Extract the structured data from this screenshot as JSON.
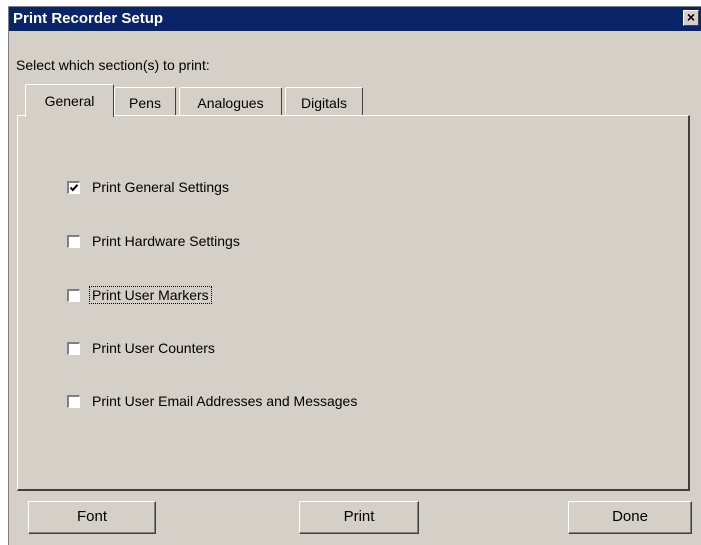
{
  "window": {
    "title": "Print Recorder Setup",
    "close_glyph": "×"
  },
  "prompt": "Select which section(s) to print:",
  "tabs": [
    {
      "label": "General",
      "active": true
    },
    {
      "label": "Pens",
      "active": false
    },
    {
      "label": "Analogues",
      "active": false
    },
    {
      "label": "Digitals",
      "active": false
    }
  ],
  "options": [
    {
      "label": "Print General Settings",
      "checked": true
    },
    {
      "label": "Print Hardware Settings",
      "checked": false
    },
    {
      "label": "Print User Markers",
      "checked": false,
      "focused": true
    },
    {
      "label": "Print User Counters",
      "checked": false
    },
    {
      "label": "Print User Email Addresses and Messages",
      "checked": false
    }
  ],
  "buttons": {
    "font": "Font",
    "print": "Print",
    "done": "Done"
  },
  "colors": {
    "titlebar": "#0a246a",
    "face": "#d4d0c8"
  },
  "icons": {
    "close": "close-icon",
    "check": "checkmark-icon"
  }
}
